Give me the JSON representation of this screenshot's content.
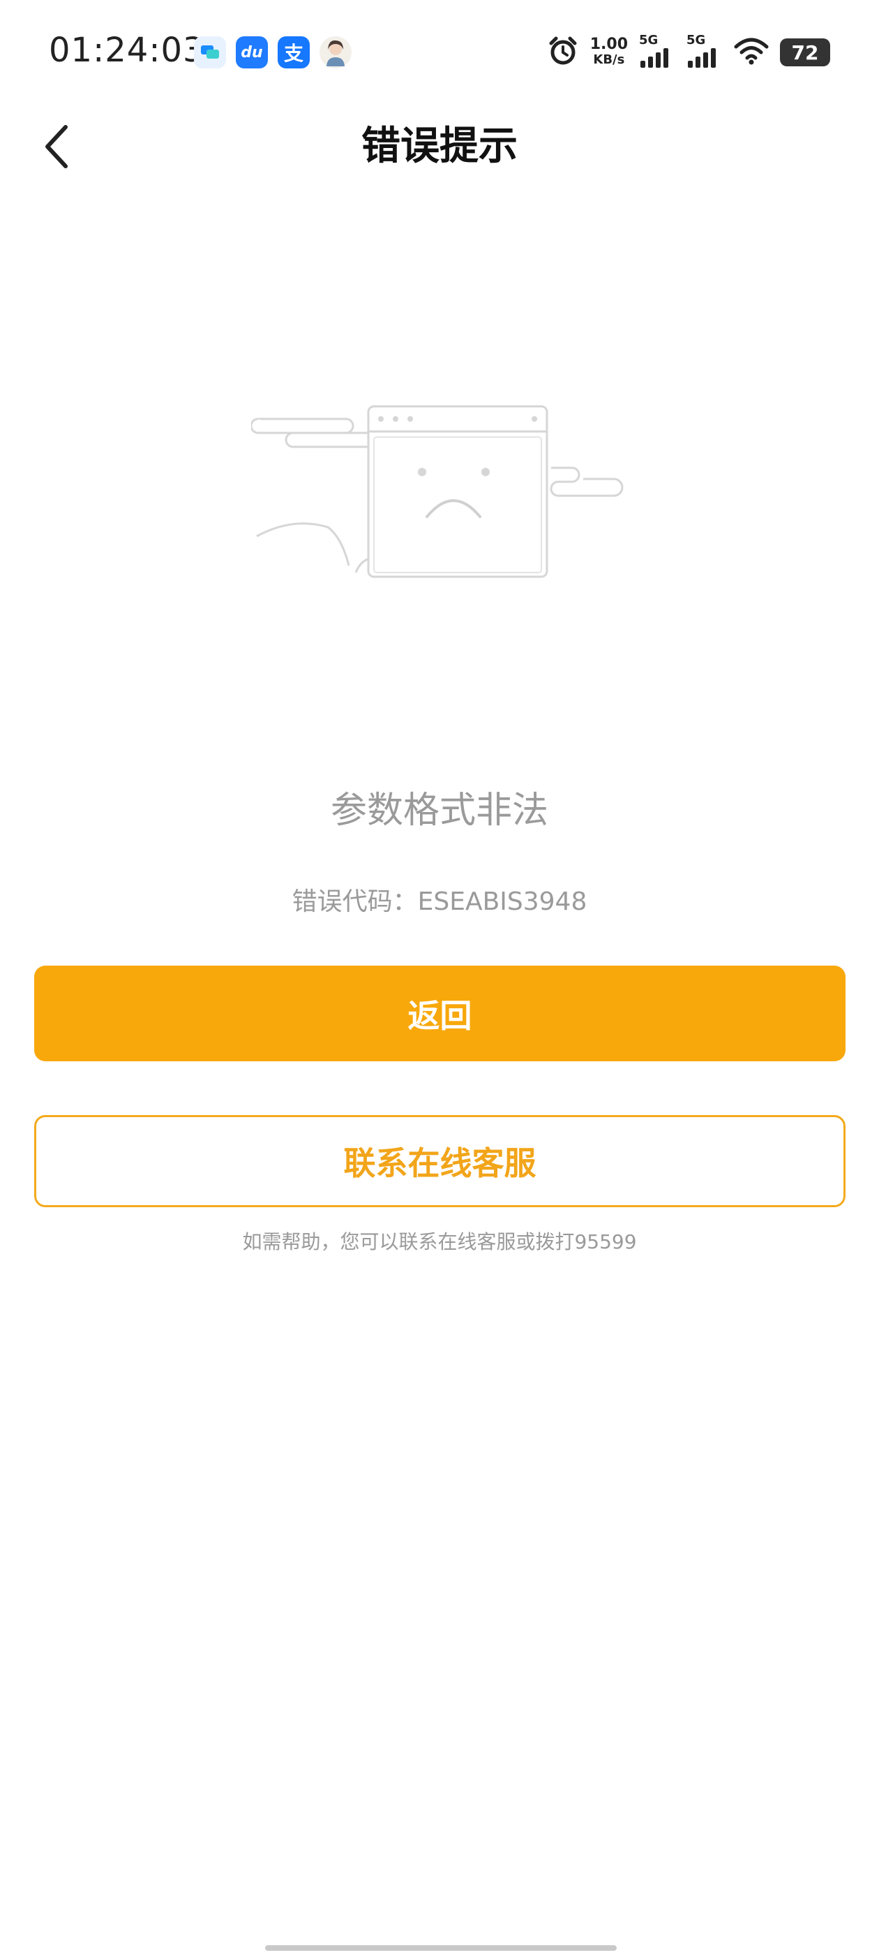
{
  "status_bar": {
    "time": "01:24:03",
    "app_icons": [
      "chat-app-icon",
      "du-app-icon",
      "alipay-icon",
      "avatar-icon"
    ],
    "alipay_glyph": "支",
    "du_glyph": "du",
    "net_speed_value": "1.00",
    "net_speed_unit": "KB/s",
    "signal_1_label": "5G",
    "signal_2_label": "5G",
    "battery_level": "72"
  },
  "nav": {
    "title": "错误提示"
  },
  "error": {
    "message": "参数格式非法",
    "code_text": "错误代码：ESEABIS3948"
  },
  "buttons": {
    "back_label": "返回",
    "service_label": "联系在线客服"
  },
  "help_text": "如需帮助，您可以联系在线客服或拨打95599",
  "colors": {
    "primary": "#f8a80b",
    "outline": "#f4aa1d",
    "muted_text": "#9a9a9a"
  }
}
